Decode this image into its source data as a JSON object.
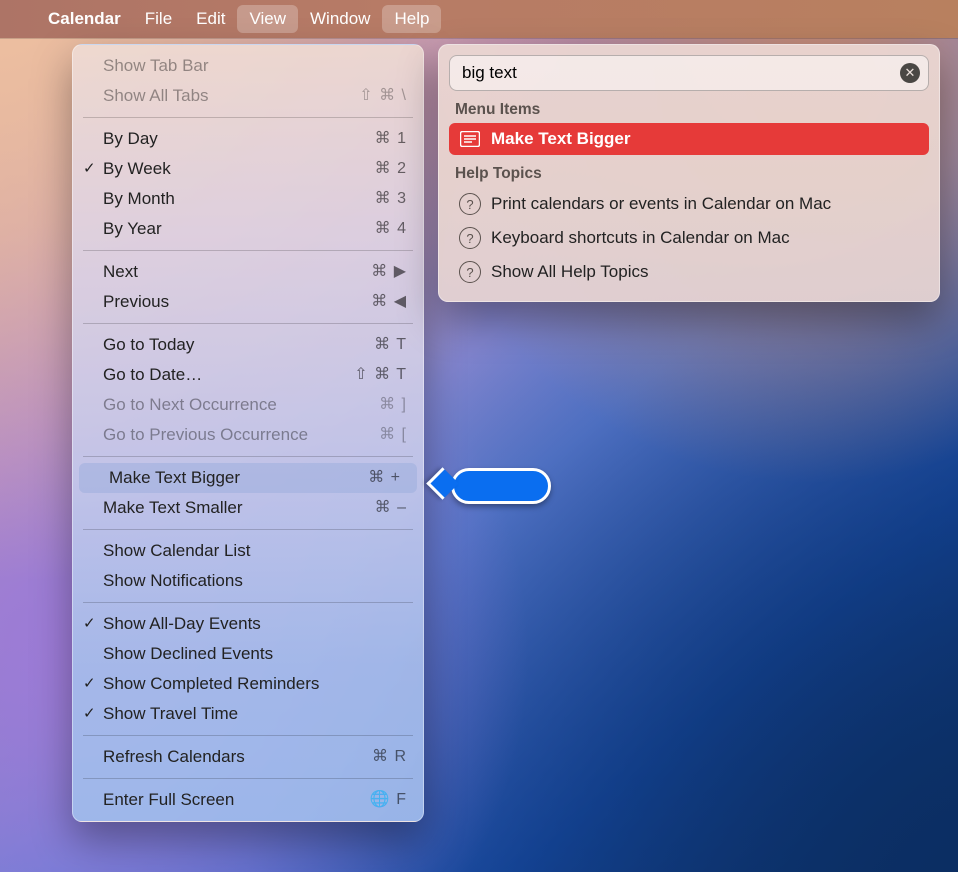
{
  "menubar": {
    "app_name": "Calendar",
    "items": [
      {
        "label": "File",
        "active": false
      },
      {
        "label": "Edit",
        "active": false
      },
      {
        "label": "View",
        "active": true
      },
      {
        "label": "Window",
        "active": false
      },
      {
        "label": "Help",
        "active": true
      }
    ]
  },
  "view_menu": {
    "groups": [
      [
        {
          "label": "Show Tab Bar",
          "shortcut": "",
          "disabled": true,
          "checked": false
        },
        {
          "label": "Show All Tabs",
          "shortcut": "⇧ ⌘ \\",
          "disabled": true,
          "checked": false
        }
      ],
      [
        {
          "label": "By Day",
          "shortcut": "⌘ 1",
          "checked": false
        },
        {
          "label": "By Week",
          "shortcut": "⌘ 2",
          "checked": true
        },
        {
          "label": "By Month",
          "shortcut": "⌘ 3",
          "checked": false
        },
        {
          "label": "By Year",
          "shortcut": "⌘ 4",
          "checked": false
        }
      ],
      [
        {
          "label": "Next",
          "shortcut": "⌘ ▶",
          "checked": false
        },
        {
          "label": "Previous",
          "shortcut": "⌘ ◀",
          "checked": false
        }
      ],
      [
        {
          "label": "Go to Today",
          "shortcut": "⌘ T",
          "checked": false
        },
        {
          "label": "Go to Date…",
          "shortcut": "⇧ ⌘ T",
          "checked": false
        },
        {
          "label": "Go to Next Occurrence",
          "shortcut": "⌘ ]",
          "checked": false,
          "disabled": true
        },
        {
          "label": "Go to Previous Occurrence",
          "shortcut": "⌘ [",
          "checked": false,
          "disabled": true
        }
      ],
      [
        {
          "label": "Make Text Bigger",
          "shortcut": "⌘ +",
          "checked": false,
          "highlight": true
        },
        {
          "label": "Make Text Smaller",
          "shortcut": "⌘ –",
          "checked": false
        }
      ],
      [
        {
          "label": "Show Calendar List",
          "shortcut": "",
          "checked": false
        },
        {
          "label": "Show Notifications",
          "shortcut": "",
          "checked": false
        }
      ],
      [
        {
          "label": "Show All-Day Events",
          "shortcut": "",
          "checked": true
        },
        {
          "label": "Show Declined Events",
          "shortcut": "",
          "checked": false
        },
        {
          "label": "Show Completed Reminders",
          "shortcut": "",
          "checked": true
        },
        {
          "label": "Show Travel Time",
          "shortcut": "",
          "checked": true
        }
      ],
      [
        {
          "label": "Refresh Calendars",
          "shortcut": "⌘ R",
          "checked": false
        }
      ],
      [
        {
          "label": "Enter Full Screen",
          "shortcut": "🌐 F",
          "checked": false
        }
      ]
    ]
  },
  "help_panel": {
    "search_value": "big text",
    "heading_menu_items": "Menu Items",
    "heading_help_topics": "Help Topics",
    "menu_results": [
      {
        "label": "Make Text Bigger",
        "selected": true
      }
    ],
    "help_results": [
      {
        "label": "Print calendars or events in Calendar on Mac"
      },
      {
        "label": "Keyboard shortcuts in Calendar on Mac"
      },
      {
        "label": "Show All Help Topics"
      }
    ]
  }
}
